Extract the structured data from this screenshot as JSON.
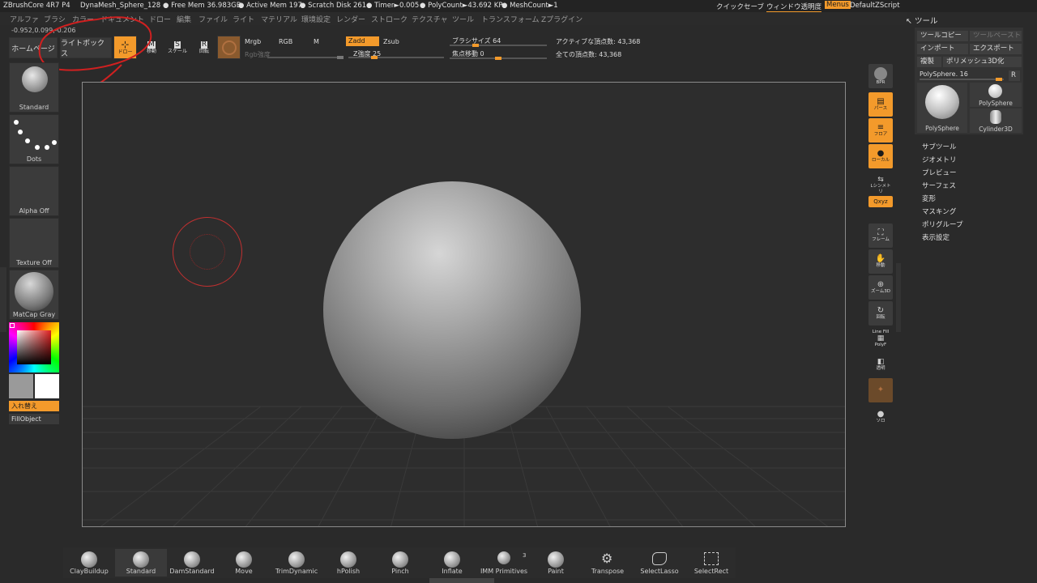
{
  "titlebar": {
    "app": "ZBrushCore 4R7 P4",
    "doc": "DynaMesh_Sphere_128",
    "free_mem": "● Free Mem 36.983GB",
    "active_mem": "● Active Mem 197",
    "scratch": "● Scratch Disk 261",
    "timer": "● Timer►0.005",
    "polycount": "● PolyCount►43.692 KP",
    "meshcount": "● MeshCount►1",
    "quicksave": "クイックセーブ",
    "window_transparency": "ウィンドウ透明度",
    "menus": "Menus",
    "default_script": "DefaultZScript"
  },
  "menubar": [
    "アルファ",
    "ブラシ",
    "カラー",
    "ドキュメント",
    "ドロー",
    "編集",
    "ファイル",
    "ライト",
    "マテリアル",
    "環境設定",
    "レンダー",
    "ストローク",
    "テクスチャ",
    "ツール",
    "トランスフォーム",
    "Zプラグイン"
  ],
  "coords": "-0.952,0.099,-0.206",
  "toolbar": {
    "home": "ホームページ",
    "lightbox": "ライトボックス",
    "draw": "ドロー",
    "move": "移動",
    "scale": "スケール",
    "rotate": "回転",
    "mrgb": "Mrgb",
    "rgb": "RGB",
    "m": "M",
    "rgb_intensity": "Rgb強度",
    "zadd": "Zadd",
    "zsub": "Zsub",
    "z_intensity": "Z強度 25",
    "brush_size": "ブラシサイズ 64",
    "focal_shift": "焦点移動 0",
    "active_points": "アクティブな頂点数: 43,368",
    "total_points": "全ての頂点数: 43,368"
  },
  "sliders": {
    "z_intensity": 0.25,
    "brush_size": 0.25,
    "focal_shift": 0.5
  },
  "left_shelf": {
    "brush": "Standard",
    "stroke": "Dots",
    "alpha": "Alpha Off",
    "texture": "Texture Off",
    "material": "MatCap Gray",
    "swap": "入れ替え",
    "fill": "FillObject"
  },
  "right_shelf": [
    "BPR",
    "パース",
    "フロア",
    "ローカル",
    "Lシンメトリ",
    "Qxyz",
    "フレーム",
    "移動",
    "ズーム3D",
    "回転",
    "Line Fill",
    "PolyF",
    "透明",
    "ソロ"
  ],
  "tool_panel": {
    "title": "ツール",
    "copy_tool": "ツールコピー",
    "paste_tool": "ツールペースト",
    "import": "インポート",
    "export": "エクスポート",
    "clone": "複製",
    "make_polymesh": "ポリメッシュ3D化",
    "current_tool": "PolySphere. 16",
    "r_button": "R",
    "thumbs": [
      "PolySphere",
      "PolySphere",
      "Cylinder3D"
    ],
    "menu": [
      "サブツール",
      "ジオメトリ",
      "プレビュー",
      "サーフェス",
      "変形",
      "マスキング",
      "ポリグループ",
      "表示設定"
    ]
  },
  "bottom_brushes": [
    "ClayBuildup",
    "Standard",
    "DamStandard",
    "Move",
    "TrimDynamic",
    "hPolish",
    "Pinch",
    "Inflate",
    "IMM Primitives",
    "Paint",
    "Transpose",
    "SelectLasso",
    "SelectRect"
  ],
  "imm_count": "3",
  "colors": {
    "accent": "#f39a2b",
    "bg": "#2a2a2a",
    "annotation": "#d02020"
  }
}
